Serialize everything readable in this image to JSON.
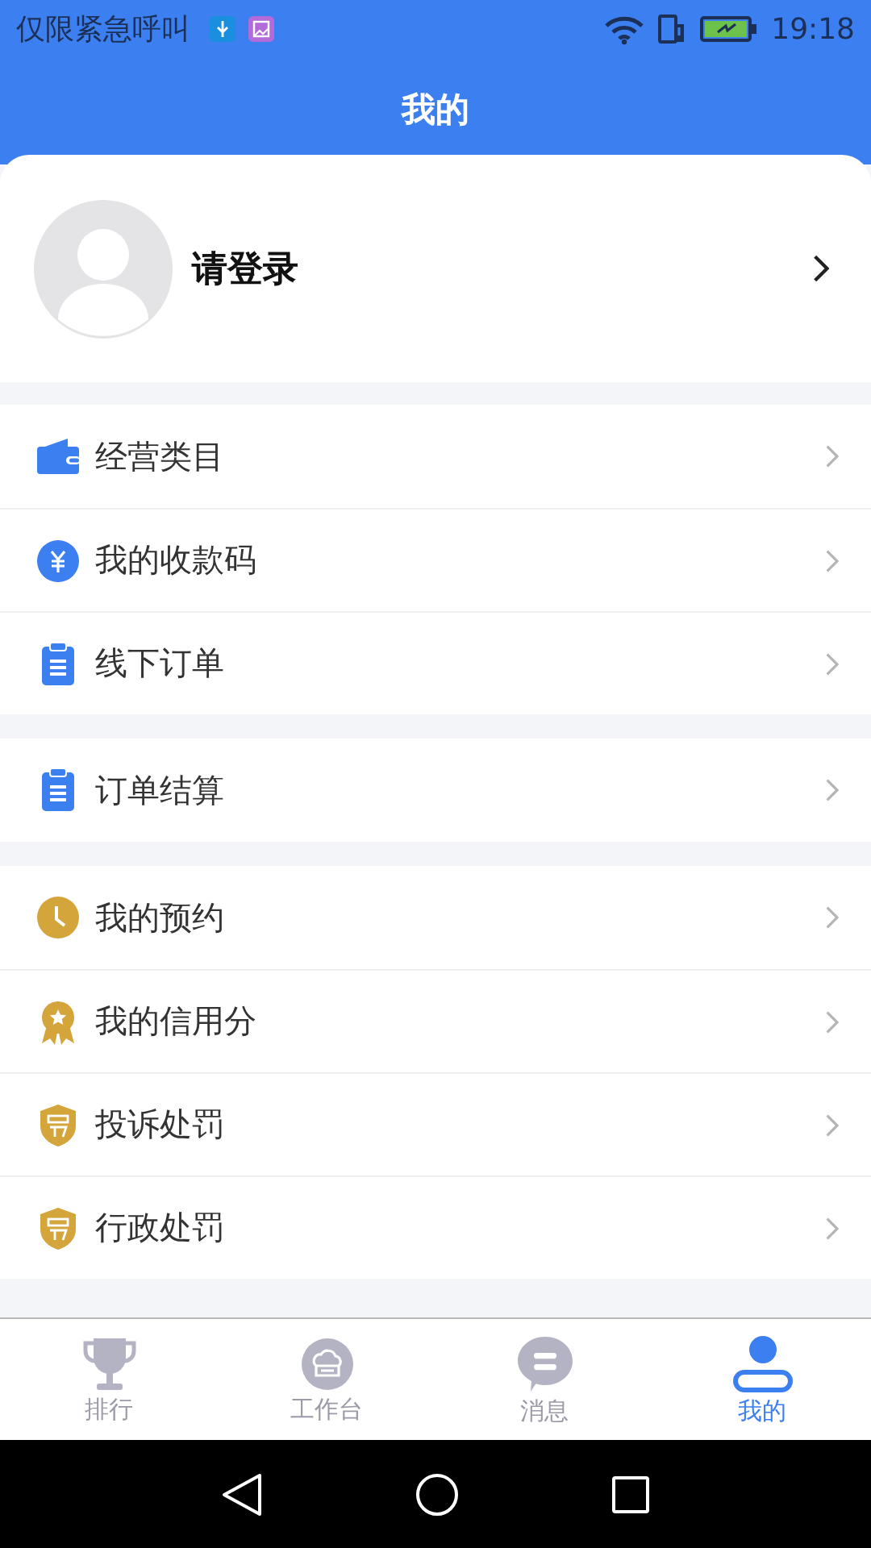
{
  "status_bar": {
    "carrier": "仅限紧急呼叫",
    "time": "19:18"
  },
  "header": {
    "title": "我的"
  },
  "profile": {
    "name": "请登录"
  },
  "groups": [
    {
      "items": [
        {
          "kind": "wallet",
          "label": "经营类目"
        },
        {
          "kind": "yuan",
          "label": "我的收款码"
        },
        {
          "kind": "clipboard",
          "label": "线下订单"
        }
      ]
    },
    {
      "items": [
        {
          "kind": "clipboard",
          "label": "订单结算"
        }
      ]
    },
    {
      "items": [
        {
          "kind": "clock",
          "label": "我的预约"
        },
        {
          "kind": "medal",
          "label": "我的信用分"
        },
        {
          "kind": "shield",
          "label": "投诉处罚"
        },
        {
          "kind": "shield",
          "label": "行政处罚"
        }
      ]
    }
  ],
  "tab_bar": [
    {
      "kind": "trophy",
      "label": "排行",
      "selected": false
    },
    {
      "kind": "workbench",
      "label": "工作台",
      "selected": false
    },
    {
      "kind": "message",
      "label": "消息",
      "selected": false
    },
    {
      "kind": "person",
      "label": "我的",
      "selected": true
    }
  ]
}
